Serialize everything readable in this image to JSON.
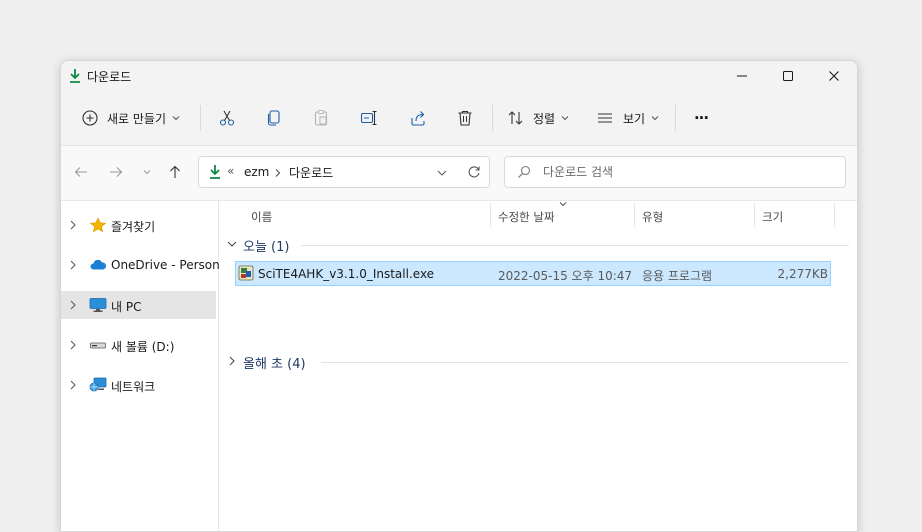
{
  "window": {
    "title": "다운로드"
  },
  "toolbar": {
    "new_label": "새로 만들기",
    "sort_label": "정렬",
    "view_label": "보기",
    "more_label": "···"
  },
  "address": {
    "overflow": "«",
    "segments": [
      "ezm",
      "다운로드"
    ]
  },
  "search": {
    "placeholder": "다운로드 검색"
  },
  "sidebar": {
    "items": [
      {
        "label": "즐겨찾기",
        "icon": "star-icon"
      },
      {
        "label": "OneDrive - Persona",
        "icon": "cloud-icon"
      },
      {
        "label": "내 PC",
        "icon": "monitor-icon"
      },
      {
        "label": "새 볼륨 (D:)",
        "icon": "drive-icon"
      },
      {
        "label": "네트워크",
        "icon": "network-icon"
      }
    ],
    "selected_index": 2
  },
  "columns": {
    "name": "이름",
    "date": "수정한 날짜",
    "type": "유형",
    "size": "크기"
  },
  "groups": [
    {
      "label": "오늘 (1)",
      "expanded": true,
      "files": [
        {
          "name": "SciTE4AHK_v3.1.0_Install.exe",
          "date": "2022-05-15 오후 10:47",
          "type": "응용 프로그램",
          "size": "2,277KB",
          "selected": true
        }
      ]
    },
    {
      "label": "올해 초 (4)",
      "expanded": false,
      "files": []
    }
  ],
  "colors": {
    "accent": "#0067c0",
    "download_green": "#0f8a45",
    "selection": "#cce8ff",
    "selection_border": "#99d1ff"
  }
}
